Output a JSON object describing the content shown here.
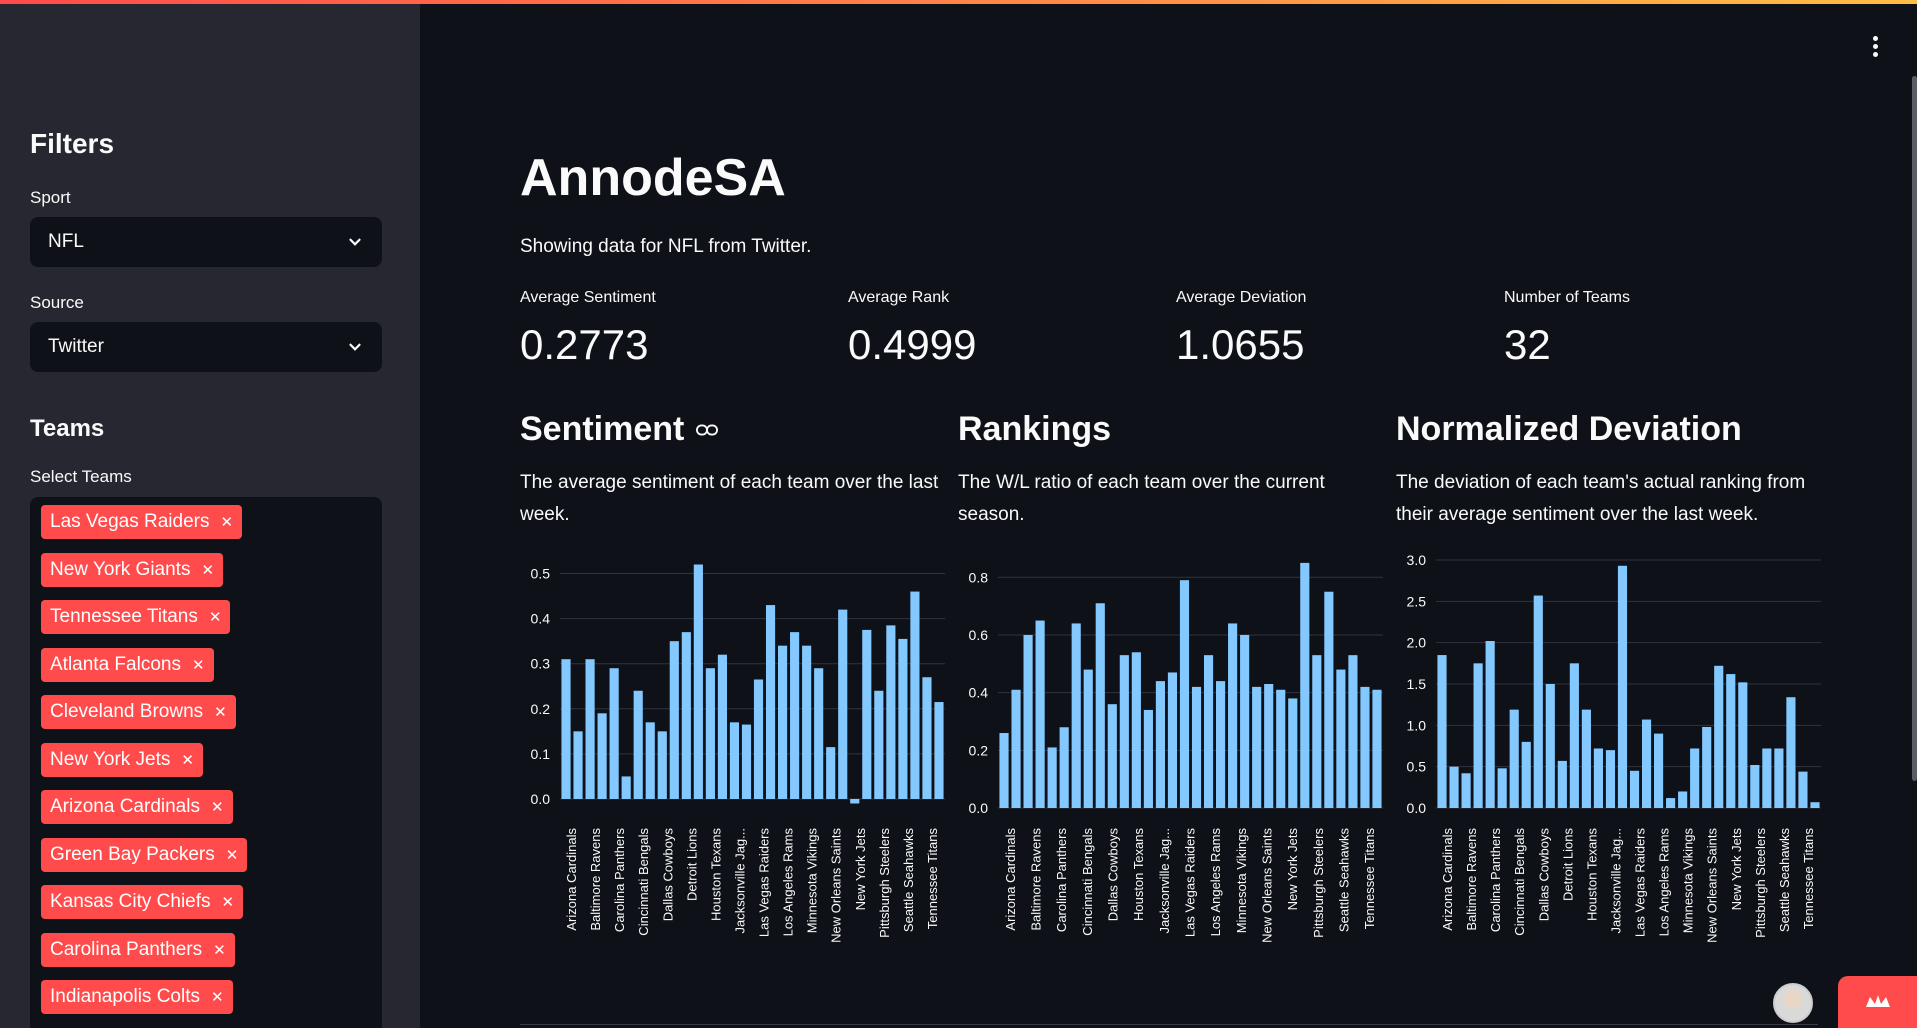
{
  "sidebar": {
    "filters_heading": "Filters",
    "sport_label": "Sport",
    "sport_value": "NFL",
    "source_label": "Source",
    "source_value": "Twitter",
    "teams_heading": "Teams",
    "select_teams_label": "Select Teams",
    "selected_teams": [
      "Las Vegas Raiders",
      "New York Giants",
      "Tennessee Titans",
      "Atlanta Falcons",
      "Cleveland Browns",
      "New York Jets",
      "Arizona Cardinals",
      "Green Bay Packers",
      "Kansas City Chiefs",
      "Carolina Panthers",
      "Indianapolis Colts"
    ]
  },
  "main": {
    "title": "AnnodeSA",
    "subtitle": "Showing data for NFL from Twitter.",
    "metrics": [
      {
        "label": "Average Sentiment",
        "value": "0.2773"
      },
      {
        "label": "Average Rank",
        "value": "0.4999"
      },
      {
        "label": "Average Deviation",
        "value": "1.0655"
      },
      {
        "label": "Number of Teams",
        "value": "32"
      }
    ],
    "sections": [
      {
        "heading": "Sentiment",
        "description": "The average sentiment of each team over the last week."
      },
      {
        "heading": "Rankings",
        "description": "The W/L ratio of each team over the current season."
      },
      {
        "heading": "Normalized Deviation",
        "description": "The deviation of each team's actual ranking from their average sentiment over the last week."
      }
    ]
  },
  "colors": {
    "accent": "#ff4b4b",
    "bar": "#83c9ff",
    "background": "#0e1117",
    "sidebar": "#262730"
  },
  "chart_data": [
    {
      "type": "bar",
      "title": "Sentiment",
      "ylim": [
        -0.02,
        0.53
      ],
      "yticks": [
        0.0,
        0.1,
        0.2,
        0.3,
        0.4,
        0.5
      ],
      "tick_labels": [
        "Arizona Cardinals",
        "Baltimore Ravens",
        "Carolina Panthers",
        "Cincinnati Bengals",
        "Dallas Cowboys",
        "Detroit Lions",
        "Houston Texans",
        "Jacksonville Jag...",
        "Las Vegas Raiders",
        "Los Angeles Rams",
        "Minnesota Vikings",
        "New Orleans Saints",
        "New York Jets",
        "Pittsburgh Steelers",
        "Seattle Seahawks",
        "Tennessee Titans"
      ],
      "values": [
        0.31,
        0.15,
        0.31,
        0.19,
        0.29,
        0.05,
        0.24,
        0.17,
        0.15,
        0.35,
        0.37,
        0.52,
        0.29,
        0.32,
        0.17,
        0.165,
        0.265,
        0.43,
        0.34,
        0.37,
        0.34,
        0.29,
        0.115,
        0.42,
        -0.01,
        0.375,
        0.24,
        0.385,
        0.355,
        0.46,
        0.27,
        0.215
      ]
    },
    {
      "type": "bar",
      "title": "Rankings",
      "ylim": [
        0,
        0.86
      ],
      "yticks": [
        0.0,
        0.2,
        0.4,
        0.6,
        0.8
      ],
      "tick_labels": [
        "Arizona Cardinals",
        "Baltimore Ravens",
        "Carolina Panthers",
        "Cincinnati Bengals",
        "Dallas Cowboys",
        "Houston Texans",
        "Jacksonville Jag...",
        "Las Vegas Raiders",
        "Los Angeles Rams",
        "Minnesota Vikings",
        "New Orleans Saints",
        "New York Jets",
        "Pittsburgh Steelers",
        "Seattle Seahawks",
        "Tennessee Titans"
      ],
      "values": [
        0.26,
        0.41,
        0.6,
        0.65,
        0.21,
        0.28,
        0.64,
        0.48,
        0.71,
        0.36,
        0.53,
        0.54,
        0.34,
        0.44,
        0.47,
        0.79,
        0.42,
        0.53,
        0.44,
        0.64,
        0.6,
        0.42,
        0.43,
        0.41,
        0.38,
        0.85,
        0.53,
        0.75,
        0.48,
        0.53,
        0.42,
        0.41
      ]
    },
    {
      "type": "bar",
      "title": "Normalized Deviation",
      "ylim": [
        0,
        3.0
      ],
      "yticks": [
        0.0,
        0.5,
        1.0,
        1.5,
        2.0,
        2.5,
        3.0
      ],
      "tick_labels": [
        "Arizona Cardinals",
        "Baltimore Ravens",
        "Carolina Panthers",
        "Cincinnati Bengals",
        "Dallas Cowboys",
        "Detroit Lions",
        "Houston Texans",
        "Jacksonville Jag...",
        "Las Vegas Raiders",
        "Los Angeles Rams",
        "Minnesota Vikings",
        "New Orleans Saints",
        "New York Jets",
        "Pittsburgh Steelers",
        "Seattle Seahawks",
        "Tennessee Titans"
      ],
      "values": [
        1.85,
        0.5,
        0.42,
        1.75,
        2.02,
        0.48,
        1.19,
        0.8,
        2.57,
        1.5,
        0.57,
        1.75,
        1.19,
        0.72,
        0.7,
        2.93,
        0.45,
        1.07,
        0.9,
        0.12,
        0.2,
        0.72,
        0.98,
        1.72,
        1.62,
        1.52,
        0.52,
        0.72,
        0.72,
        1.34,
        0.44,
        0.07
      ]
    }
  ]
}
